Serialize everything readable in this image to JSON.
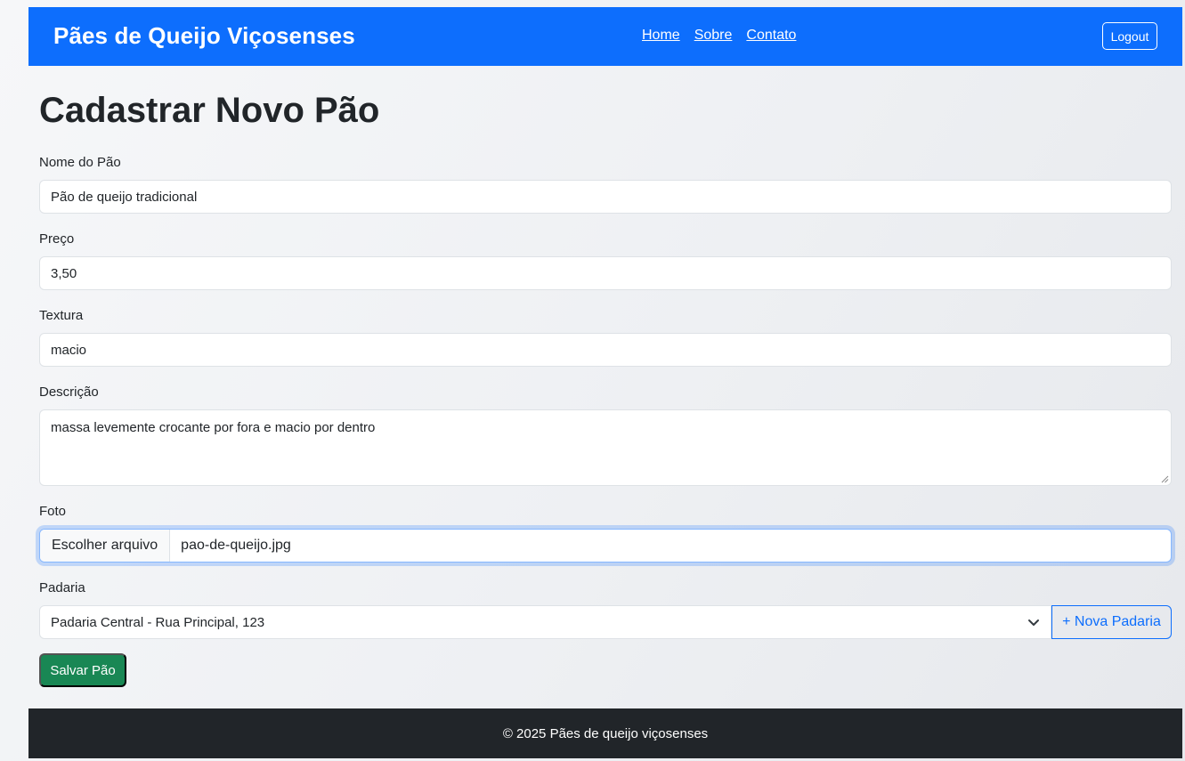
{
  "navbar": {
    "brand": "Pães de Queijo Viçosenses",
    "links": [
      "Home",
      "Sobre",
      "Contato"
    ],
    "logout_label": "Logout"
  },
  "page": {
    "title": "Cadastrar Novo Pão"
  },
  "form": {
    "nome": {
      "label": "Nome do Pão",
      "value": "Pão de queijo tradicional"
    },
    "preco": {
      "label": "Preço",
      "value": "3,50"
    },
    "textura": {
      "label": "Textura",
      "value": "macio"
    },
    "descricao": {
      "label": "Descrição",
      "value": "massa levemente crocante por fora e macio por dentro"
    },
    "foto": {
      "label": "Foto",
      "button_label": "Escolher arquivo",
      "file_name": "pao-de-queijo.jpg"
    },
    "padaria": {
      "label": "Padaria",
      "selected": "Padaria Central - Rua Principal, 123",
      "new_button_label": "+ Nova Padaria"
    },
    "submit_label": "Salvar Pão"
  },
  "footer": {
    "text": "© 2025 Pães de queijo viçosenses"
  },
  "colors": {
    "primary": "#0d6efd",
    "success": "#198754",
    "dark": "#212529"
  },
  "icons": {
    "select": "chevron-down-icon"
  }
}
